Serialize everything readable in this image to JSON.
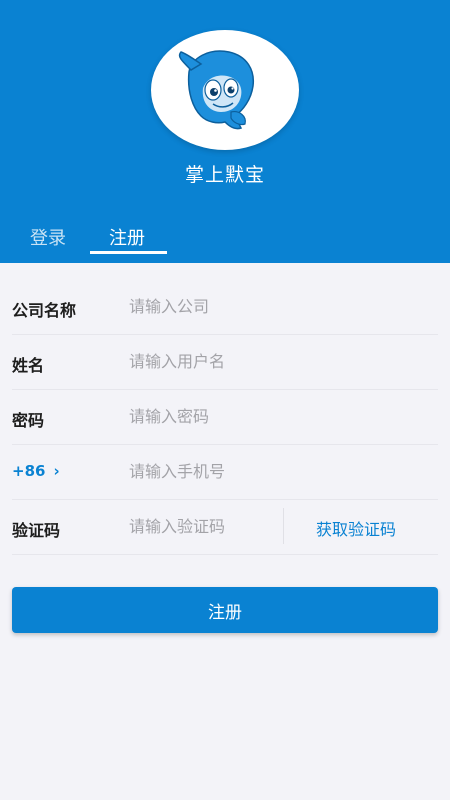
{
  "header": {
    "app_name": "掌上默宝",
    "logo_icon": "dolphin-mascot-logo",
    "brand_color": "#0a82d2"
  },
  "tabs": [
    {
      "label": "登录",
      "active": false
    },
    {
      "label": "注册",
      "active": true
    }
  ],
  "form": {
    "company": {
      "label": "公司名称",
      "placeholder": "请输入公司"
    },
    "name": {
      "label": "姓名",
      "placeholder": "请输入用户名"
    },
    "password": {
      "label": "密码",
      "placeholder": "请输入密码"
    },
    "phone": {
      "country_code": "+86",
      "chevron_icon": "chevron-right-icon",
      "placeholder": "请输入手机号"
    },
    "code": {
      "label": "验证码",
      "placeholder": "请输入验证码",
      "get_code_label": "获取验证码"
    }
  },
  "submit_label": "注册"
}
